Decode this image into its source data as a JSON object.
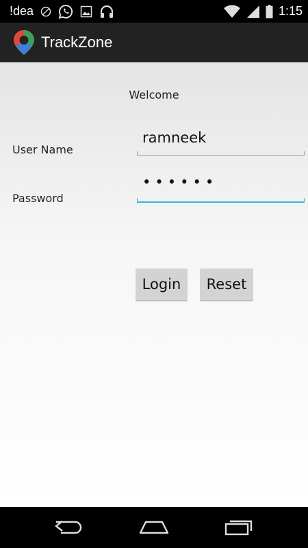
{
  "status_bar": {
    "carrier": "!dea",
    "time": "1:15",
    "icons": [
      "sync-off-icon",
      "whatsapp-icon",
      "image-icon",
      "headphones-icon",
      "wifi-icon",
      "signal-icon",
      "battery-icon"
    ]
  },
  "app": {
    "title": "TrackZone"
  },
  "form": {
    "welcome": "Welcome",
    "username_label": "User Name",
    "username_value": "ramneek",
    "password_label": "Password",
    "password_value": "••••••",
    "login_label": "Login",
    "reset_label": "Reset"
  },
  "colors": {
    "action_bar": "#222222",
    "focus_underline": "#33b5e5",
    "button_bg": "#d3d3d3"
  }
}
